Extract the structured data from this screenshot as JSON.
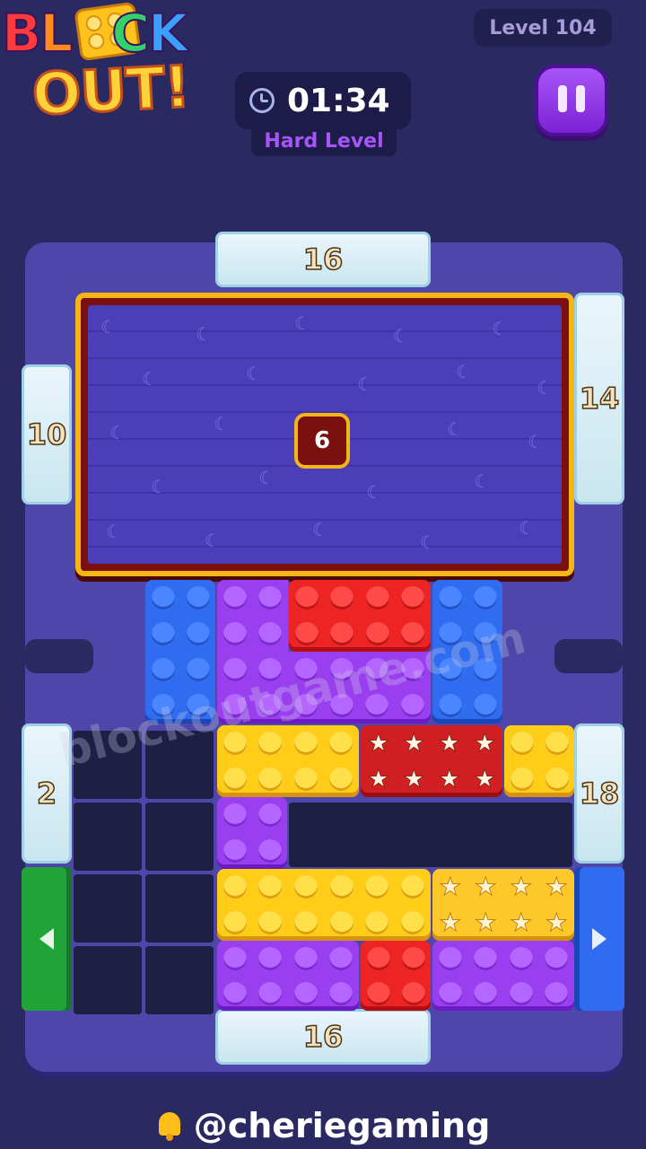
{
  "header": {
    "logo_line1": [
      "B",
      "L",
      "O",
      "C",
      "K"
    ],
    "logo_line2": "OUT!",
    "level": "Level 104",
    "timer": "01:34",
    "difficulty": "Hard Level",
    "pause_icon": "pause-icon",
    "clock_icon": "clock-icon"
  },
  "board": {
    "gates": {
      "top": "16",
      "left_upper": "10",
      "right_upper": "14",
      "left_lower": "2",
      "right_lower": "18",
      "bottom": "16"
    },
    "arrow_gates": {
      "left": {
        "icon": "arrow-left-icon",
        "color": "#22a33a"
      },
      "right": {
        "icon": "arrow-right-icon",
        "color": "#2f6cf0"
      }
    },
    "frozen_block_counter": "6",
    "colors": {
      "blue": "#2f6cf0",
      "purple": "#9a3ff0",
      "red": "#ee2323",
      "yellow": "#ffcc18",
      "gate": "#dff0f7",
      "frame": "#f4b516"
    }
  },
  "watermark": "blockoutgame.com",
  "footer": {
    "bell_icon": "bell-icon",
    "handle": "@cheriegaming"
  }
}
